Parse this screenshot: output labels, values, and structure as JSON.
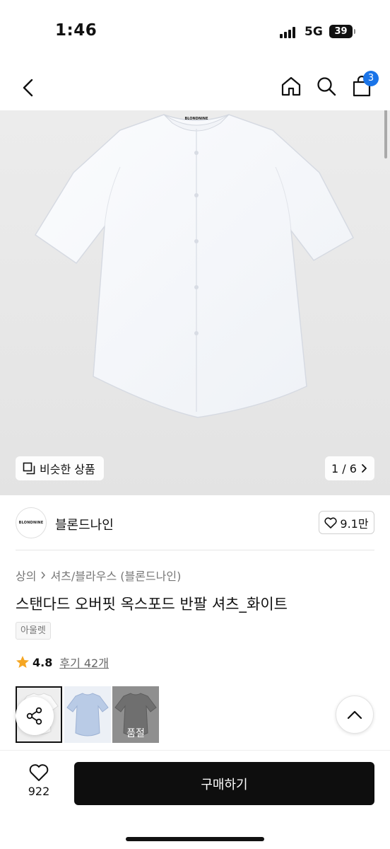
{
  "status": {
    "time": "1:46",
    "network": "5G",
    "battery": "39"
  },
  "nav": {
    "cart_count": "3",
    "icons": [
      "chevron-left-icon",
      "home-icon",
      "search-icon",
      "shopping-bag-icon"
    ]
  },
  "hero": {
    "similar_label": "비슷한 상품",
    "page_counter": "1 / 6",
    "shirt_tag_text": "BLONDNINE"
  },
  "brand": {
    "logo_text": "BLONDNINE",
    "name": "블론드나인",
    "likes": "9.1만"
  },
  "product": {
    "breadcrumb": [
      "상의",
      "셔츠/블라우스 (블론드나인)"
    ],
    "title": "스탠다드 오버핏 옥스포드 반팔 셔츠_화이트",
    "tag": "아울렛",
    "rating": "4.8",
    "reviews": "후기 42개"
  },
  "thumbnails": [
    {
      "color": "white",
      "selected": true
    },
    {
      "color": "light-blue",
      "selected": false
    },
    {
      "color": "gray",
      "selected": false,
      "status": "품절"
    }
  ],
  "bottom": {
    "wish_count": "922",
    "buy_label": "구매하기"
  },
  "colors": {
    "accent": "#1a74e8",
    "rating_star": "#f5a623",
    "buy_button": "#0e0e0e",
    "hero_bg": "#e8e8e8"
  }
}
